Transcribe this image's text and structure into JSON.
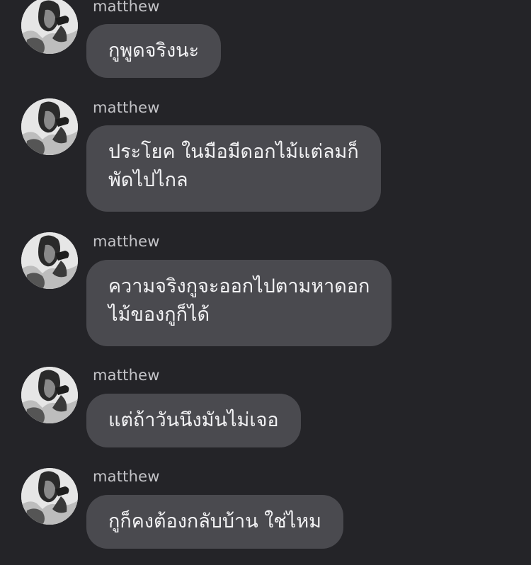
{
  "messages": [
    {
      "sender": "matthew",
      "avatar": "avatar-photo-icon",
      "text": "กูพูดจริงนะ"
    },
    {
      "sender": "matthew",
      "avatar": "avatar-photo-icon",
      "text": "ประโยค ในมือมีดอกไม้แต่ลมก็\nพัดไปไกล"
    },
    {
      "sender": "matthew",
      "avatar": "avatar-photo-icon",
      "text": "ความจริงกูจะออกไปตามหาดอก\nไม้ของกูก็ได้"
    },
    {
      "sender": "matthew",
      "avatar": "avatar-photo-icon",
      "text": "แต่ถ้าวันนึงมันไม่เจอ"
    },
    {
      "sender": "matthew",
      "avatar": "avatar-photo-icon",
      "text": "กูก็คงต้องกลับบ้าน ใช่ไหม"
    }
  ],
  "colors": {
    "background": "#242428",
    "bubble": "#4a4a4f",
    "bubble_text": "#f2f2f4",
    "sender_text": "#c4c4c8"
  }
}
